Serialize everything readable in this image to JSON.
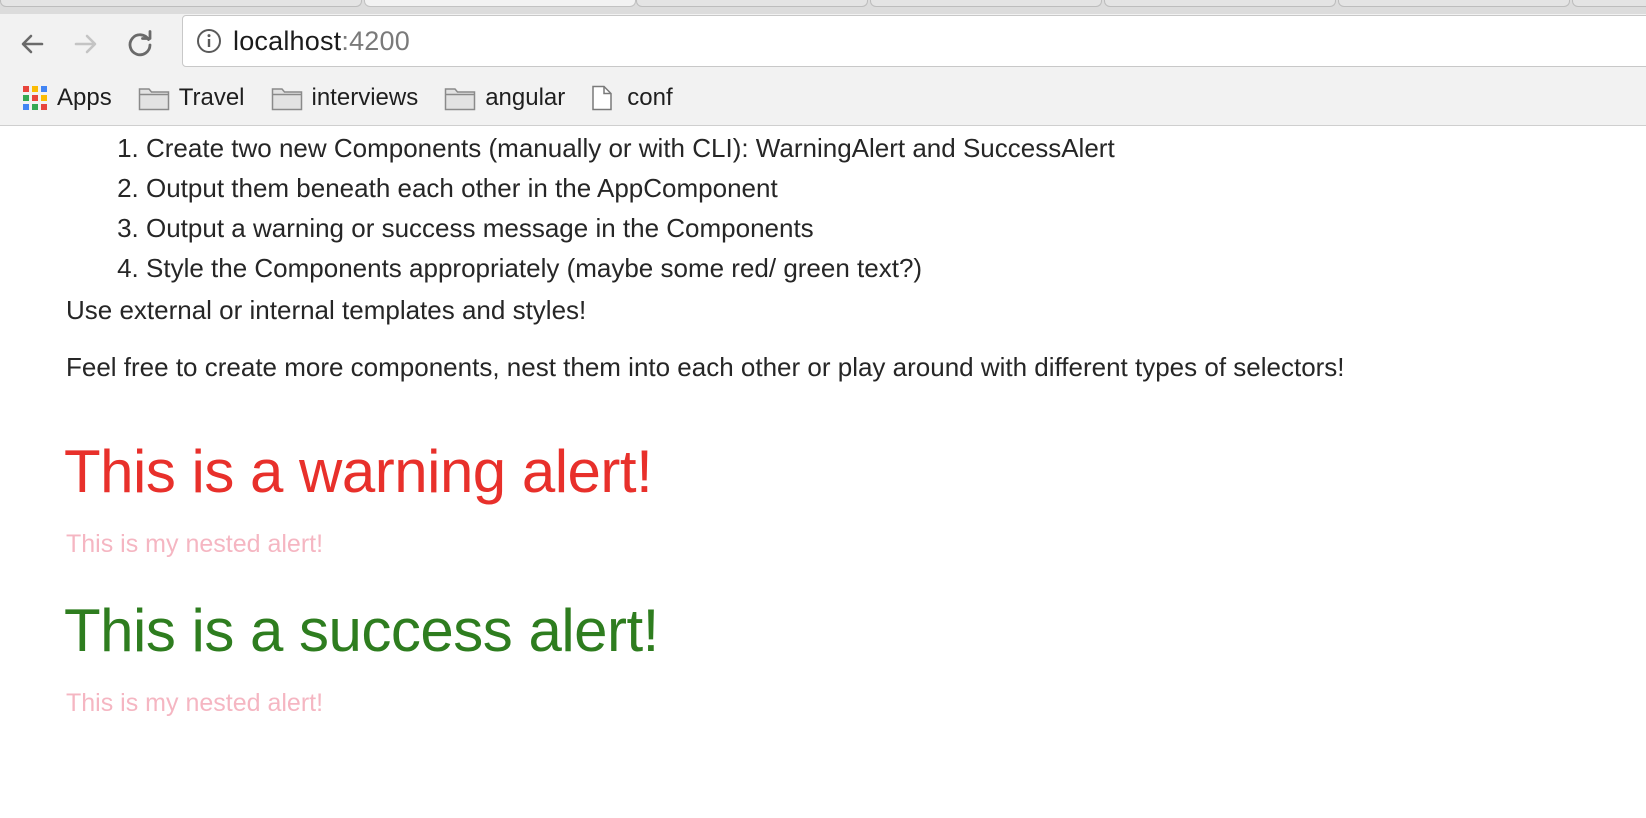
{
  "browser": {
    "address": {
      "host": "localhost",
      "port": ":4200"
    },
    "bookmarks": [
      {
        "label": "Apps",
        "icon": "apps-grid-icon"
      },
      {
        "label": "Travel",
        "icon": "folder-icon"
      },
      {
        "label": "interviews",
        "icon": "folder-icon"
      },
      {
        "label": "angular",
        "icon": "folder-icon"
      },
      {
        "label": "conf",
        "icon": "page-icon"
      }
    ]
  },
  "content": {
    "tasks": [
      "Create two new Components (manually or with CLI): WarningAlert and SuccessAlert",
      "Output them beneath each other in the AppComponent",
      "Output a warning or success message in the Components",
      "Style the Components appropriately (maybe some red/ green text?)"
    ],
    "note_templates": "Use external or internal templates and styles!",
    "note_components": "Feel free to create more components, nest them into each other or play around with different types of selectors!",
    "warning_alert": {
      "heading": "This is a warning alert!",
      "nested": "This is my nested alert!",
      "color": "#e8302b"
    },
    "success_alert": {
      "heading": "This is a success alert!",
      "nested": "This is my nested alert!",
      "color": "#2e7d1f"
    },
    "nested_color": "#f5b6c2"
  }
}
